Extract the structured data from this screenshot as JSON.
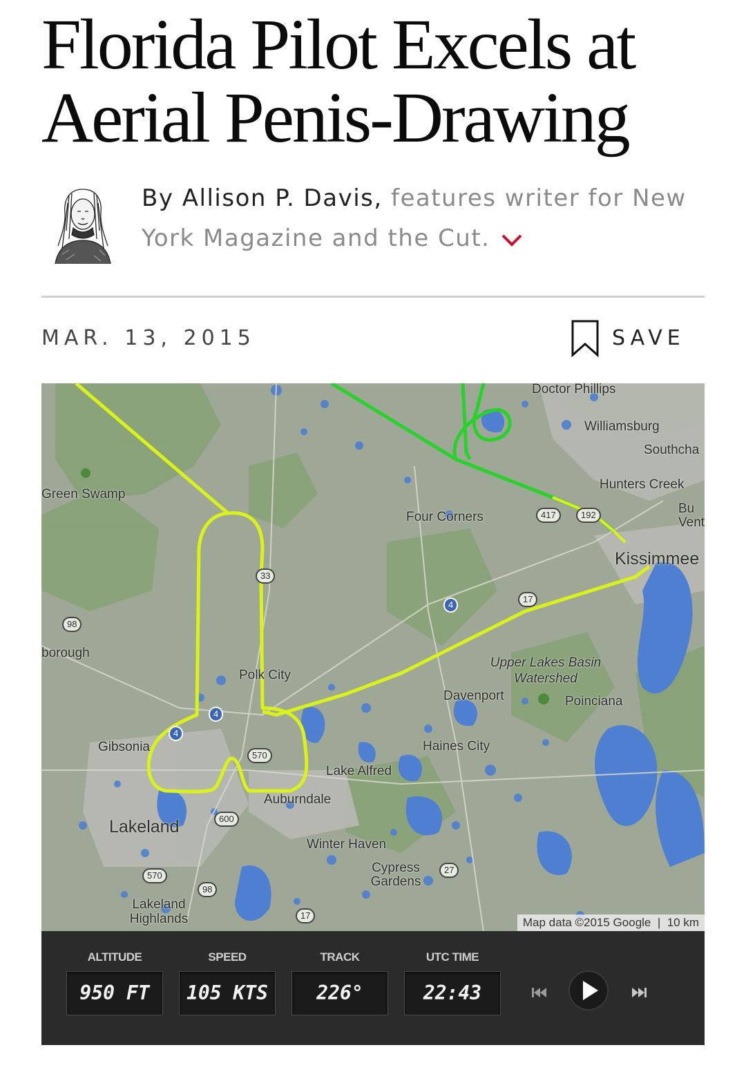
{
  "article": {
    "headline_line1": "Florida Pilot Excels at",
    "headline_line2": "Aerial Penis-Drawing",
    "byline_prefix": "By ",
    "author": "Allison P. Davis,",
    "author_desc_line1": " features writer for New",
    "author_desc_line2": "York Magazine and the Cut.",
    "date": "MAR. 13, 2015",
    "save_label": "SAVE"
  },
  "map": {
    "places": {
      "green_swamp": "Green Swamp",
      "borough": "borough",
      "polk_city": "Polk City",
      "gibsonia": "Gibsonia",
      "lakeland": "Lakeland",
      "lakeland_highlands": "Lakeland Highlands",
      "auburndale": "Auburndale",
      "lake_alfred": "Lake Alfred",
      "winter_haven": "Winter Haven",
      "cypress_gardens": "Cypress Gardens",
      "haines_city": "Haines City",
      "davenport": "Davenport",
      "poinciana": "Poinciana",
      "upper_lakes": "Upper Lakes Basin Watershed",
      "four_corners": "Four Corners",
      "kissimmee": "Kissimmee",
      "doctor_phillips": "Doctor Phillips",
      "williamsburg": "Williamsburg",
      "southchase": "Southcha",
      "hunters_creek": "Hunters Creek",
      "buena_ventura": "Bu Ventur"
    },
    "shields": {
      "s98_a": "98",
      "s33": "33",
      "s570_a": "570",
      "s570_b": "570",
      "s600": "600",
      "s98_b": "98",
      "s17_a": "17",
      "s17_b": "17",
      "s27": "27",
      "s417": "417",
      "s192": "192",
      "i4_a": "4",
      "i4_b": "4",
      "i4_c": "4"
    },
    "attribution": "Map data ©2015 Google",
    "scale": "10 km",
    "colors": {
      "track_yellow": "#d9f21a",
      "track_green": "#28d22a",
      "water": "#4f7fd0",
      "land": "#9fa797"
    }
  },
  "flight_panel": {
    "altitude_label": "ALTITUDE",
    "altitude_value": "950 FT",
    "speed_label": "SPEED",
    "speed_value": "105 KTS",
    "track_label": "TRACK",
    "track_value": "226°",
    "utc_label": "UTC TIME",
    "utc_value": "22:43",
    "controls": [
      "skip-back-icon",
      "play-icon",
      "skip-forward-icon"
    ]
  }
}
